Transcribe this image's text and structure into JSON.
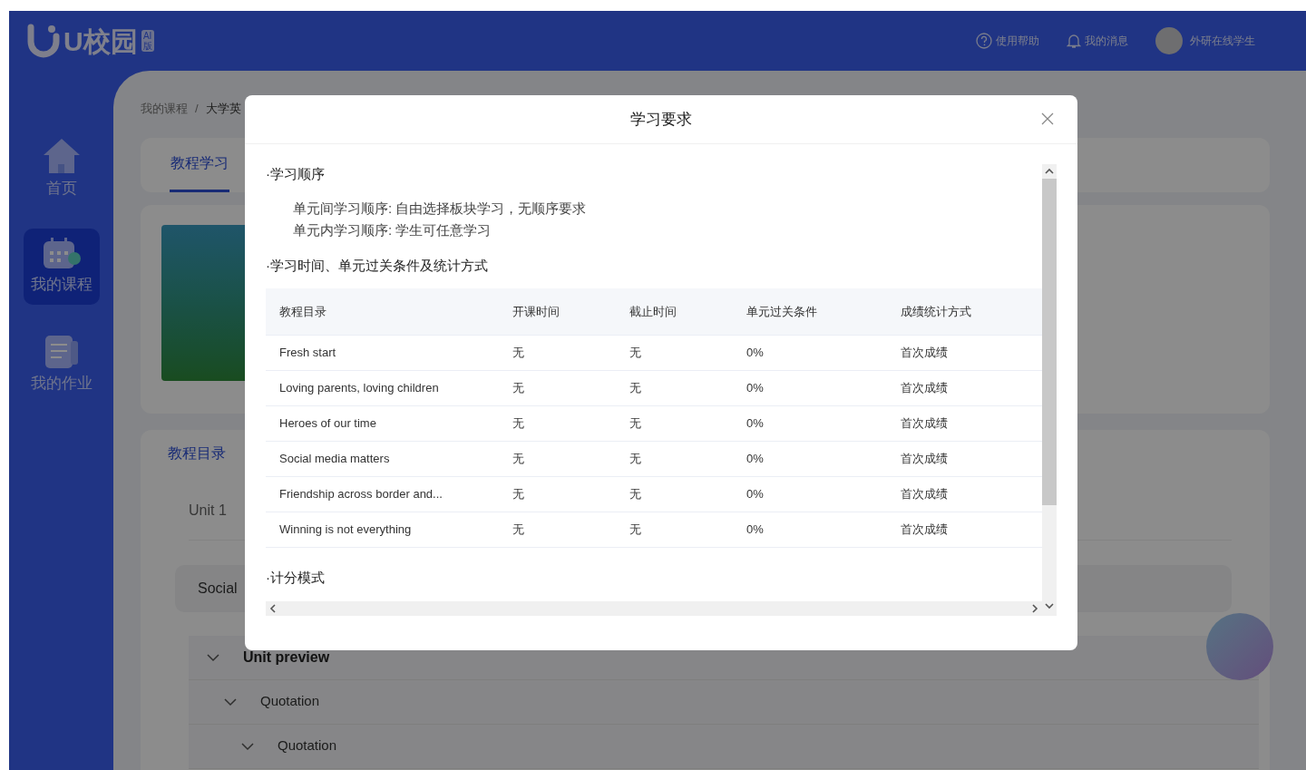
{
  "header": {
    "logo": "U校园",
    "logo_badge": "AI版",
    "help": "使用帮助",
    "messages": "我的消息",
    "user": "外研在线学生"
  },
  "sidebar": {
    "items": [
      {
        "label": "首页",
        "kind": "home",
        "selected": false
      },
      {
        "label": "我的课程",
        "kind": "calendar",
        "selected": true
      },
      {
        "label": "我的作业",
        "kind": "document",
        "selected": false
      }
    ]
  },
  "breadcrumb": [
    "我的课程",
    "大学英"
  ],
  "breadcrumb_separator": "/",
  "course_tabs": [
    {
      "label": "教程学习",
      "selected": true
    }
  ],
  "catalog": {
    "title": "教程目录",
    "unit": "Unit 1",
    "current": "Social",
    "tree": [
      {
        "label": "Unit preview",
        "expanded": true,
        "children": [
          {
            "label": "Quotation",
            "expanded": true,
            "children": [
              {
                "label": "Quotation",
                "expanded": true
              }
            ]
          }
        ]
      }
    ]
  },
  "dialog": {
    "title": "学习要求",
    "sections": [
      {
        "heading": "·学习顺序",
        "lines": [
          "单元间学习顺序: 自由选择板块学习，无顺序要求",
          "单元内学习顺序: 学生可任意学习"
        ]
      },
      {
        "heading": "·学习时间、单元过关条件及统计方式",
        "table": {
          "columns": [
            "教程目录",
            "开课时间",
            "截止时间",
            "单元过关条件",
            "成绩统计方式"
          ],
          "rows": [
            [
              "Fresh start",
              "无",
              "无",
              "0%",
              "首次成绩"
            ],
            [
              "Loving parents, loving children",
              "无",
              "无",
              "0%",
              "首次成绩"
            ],
            [
              "Heroes of our time",
              "无",
              "无",
              "0%",
              "首次成绩"
            ],
            [
              "Social media matters",
              "无",
              "无",
              "0%",
              "首次成绩"
            ],
            [
              "Friendship across border and...",
              "无",
              "无",
              "0%",
              "首次成绩"
            ],
            [
              "Winning is not everything",
              "无",
              "无",
              "0%",
              "首次成绩"
            ]
          ]
        }
      },
      {
        "heading": "·计分模式"
      }
    ]
  }
}
